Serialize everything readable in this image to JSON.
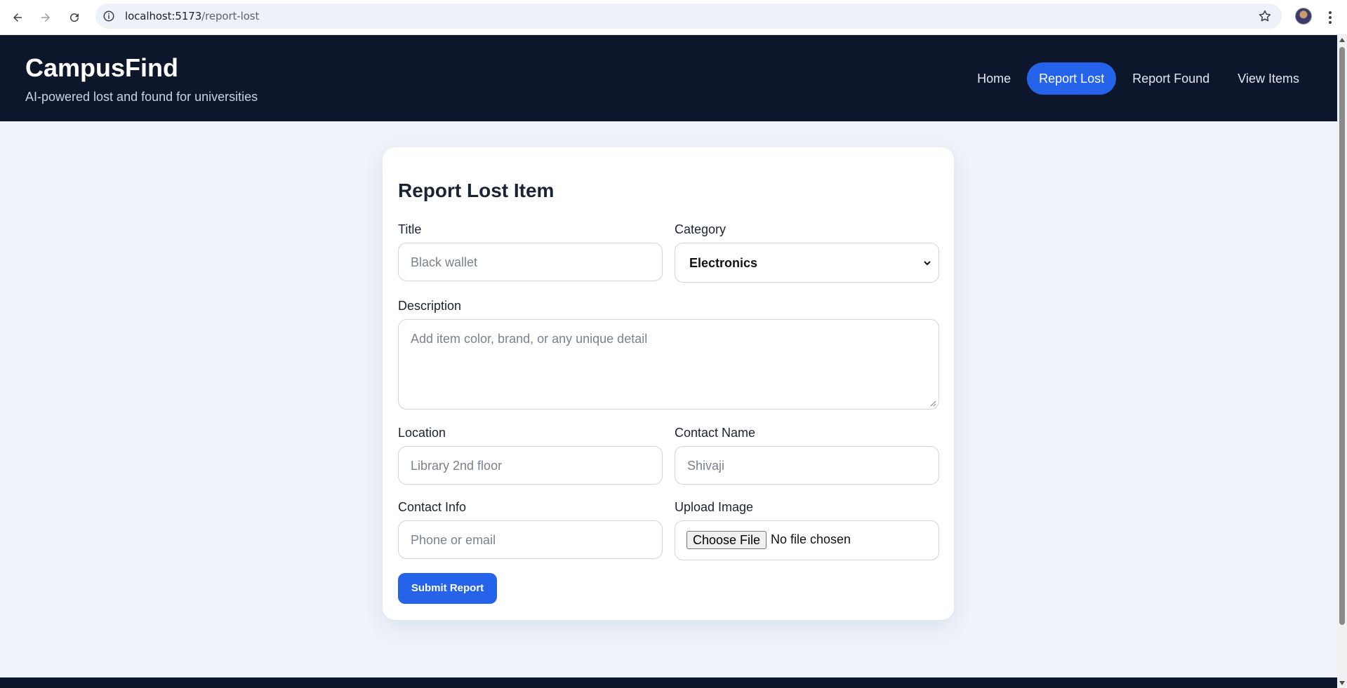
{
  "browser": {
    "url_host": "localhost:5173",
    "url_path": "/report-lost"
  },
  "header": {
    "title": "CampusFind",
    "subtitle": "AI-powered lost and found for universities",
    "nav": [
      {
        "label": "Home"
      },
      {
        "label": "Report Lost"
      },
      {
        "label": "Report Found"
      },
      {
        "label": "View Items"
      }
    ],
    "active_nav": "Report Lost"
  },
  "form": {
    "heading": "Report Lost Item",
    "title_label": "Title",
    "title_placeholder": "Black wallet",
    "category_label": "Category",
    "category_value": "Electronics",
    "description_label": "Description",
    "description_placeholder": "Add item color, brand, or any unique detail",
    "location_label": "Location",
    "location_placeholder": "Library 2nd floor",
    "contact_name_label": "Contact Name",
    "contact_name_placeholder": "Shivaji",
    "contact_info_label": "Contact Info",
    "contact_info_placeholder": "Phone or email",
    "upload_label": "Upload Image",
    "choose_file_label": "Choose File",
    "no_file_text": "No file chosen",
    "submit_label": "Submit Report"
  },
  "colors": {
    "header_bg": "#0d172b",
    "accent": "#2563eb",
    "page_bg": "#eef3fb"
  }
}
